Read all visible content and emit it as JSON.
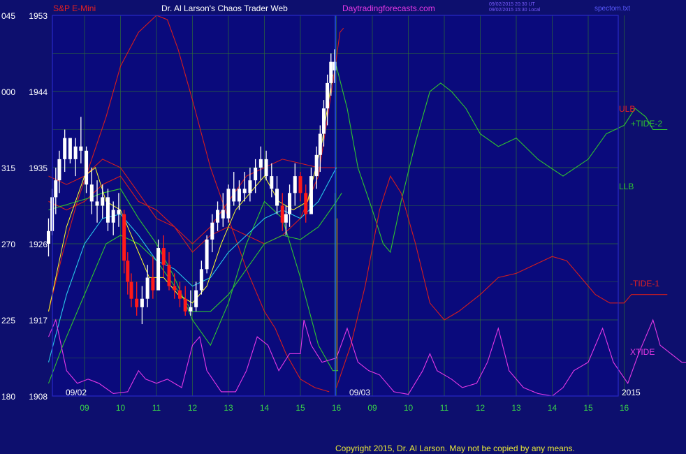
{
  "header": {
    "symbol": "S&P E-Mini",
    "title": "Dr. Al Larson's Chaos Trader Web",
    "site": "Daytradingforecasts.com",
    "timestamp_utc": "09/02/2015 20:30 UT",
    "timestamp_local": "09/02/2015 15:30 Local",
    "file": "spectom.txt"
  },
  "footer": {
    "copyright": "Copyright 2015, Dr. Al Larson. May not be copied by any means."
  },
  "colors": {
    "background": "#0d0f6e",
    "plot_background": "#0a0a7c",
    "grid": "#2e6a3a",
    "frame": "#2828c8",
    "axis_text_y": "#ffffff",
    "axis_text_x": "#39d24a",
    "red_series": "#d61d1d",
    "green_series": "#2fc52f",
    "cyan_series": "#28c8e8",
    "yellow_series": "#ffff28",
    "magenta_series": "#e638e6",
    "bars": "#ffffff",
    "bars_down": "#ff1a1a",
    "divider": "#2a6cff",
    "magenta_text": "#e638e6",
    "red_text": "#e82020"
  },
  "chart_data": {
    "type": "line",
    "y_axis": {
      "price_ticks": [
        "1908",
        "1917",
        "1926",
        "1935",
        "1944",
        "1953"
      ],
      "left_ticks": [
        "180",
        "225",
        "270",
        "315",
        "000",
        "045"
      ],
      "ylim": [
        1908,
        1953
      ]
    },
    "x_axis": {
      "hour_ticks": [
        "09",
        "10",
        "11",
        "12",
        "13",
        "14",
        "15",
        "16",
        "09",
        "10",
        "11",
        "12",
        "13",
        "14",
        "15",
        "16"
      ],
      "date_labels": [
        "09/02",
        "09/03"
      ],
      "year_label": "2015"
    },
    "grid": true,
    "day_divider_hour": 16,
    "series_labels": [
      {
        "text": "ULB",
        "color": "red"
      },
      {
        "text": "+TIDE-2",
        "color": "green"
      },
      {
        "text": "LLB",
        "color": "green"
      },
      {
        "text": "-TIDE-1",
        "color": "red"
      },
      {
        "text": "XTIDE",
        "color": "magenta"
      }
    ],
    "price_bars_day1": [
      [
        8.0,
        1924.5,
        1929.0,
        1926.0,
        1927.5
      ],
      [
        8.1,
        1927.0,
        1932.5,
        1927.5,
        1931.5
      ],
      [
        8.2,
        1929.5,
        1935.0,
        1931.5,
        1933.5
      ],
      [
        8.3,
        1932.0,
        1937.0,
        1933.5,
        1936.0
      ],
      [
        8.45,
        1934.5,
        1939.5,
        1936.0,
        1938.5
      ],
      [
        8.6,
        1935.5,
        1938.0,
        1938.5,
        1936.0
      ],
      [
        8.75,
        1934.0,
        1938.5,
        1936.0,
        1937.5
      ],
      [
        8.9,
        1935.5,
        1941.0,
        1937.5,
        1937.0
      ],
      [
        9.05,
        1932.0,
        1937.5,
        1937.0,
        1933.0
      ],
      [
        9.2,
        1929.5,
        1935.0,
        1933.0,
        1931.0
      ],
      [
        9.35,
        1928.5,
        1933.5,
        1931.0,
        1930.5
      ],
      [
        9.5,
        1929.0,
        1933.0,
        1930.5,
        1931.5
      ],
      [
        9.65,
        1927.5,
        1932.5,
        1931.5,
        1928.5
      ],
      [
        9.8,
        1927.0,
        1931.0,
        1928.5,
        1930.0
      ],
      [
        9.95,
        1928.0,
        1932.0,
        1930.0,
        1929.5
      ],
      [
        10.1,
        1922.5,
        1930.0,
        1929.5,
        1924.0
      ],
      [
        10.2,
        1920.0,
        1925.0,
        1924.0,
        1921.5
      ],
      [
        10.3,
        1918.5,
        1922.5,
        1921.5,
        1919.5
      ],
      [
        10.45,
        1917.5,
        1921.5,
        1919.5,
        1918.5
      ],
      [
        10.6,
        1916.5,
        1921.0,
        1918.5,
        1919.5
      ],
      [
        10.75,
        1918.5,
        1923.5,
        1919.5,
        1922.0
      ],
      [
        10.9,
        1919.5,
        1924.5,
        1922.0,
        1920.5
      ],
      [
        11.05,
        1921.0,
        1926.5,
        1920.5,
        1925.5
      ],
      [
        11.2,
        1922.0,
        1927.0,
        1925.5,
        1923.5
      ],
      [
        11.35,
        1920.5,
        1925.0,
        1923.5,
        1921.0
      ],
      [
        11.5,
        1919.5,
        1922.5,
        1921.0,
        1920.5
      ],
      [
        11.65,
        1918.5,
        1921.5,
        1920.5,
        1919.5
      ],
      [
        11.8,
        1917.5,
        1921.0,
        1919.5,
        1918.0
      ],
      [
        11.95,
        1917.5,
        1920.5,
        1918.0,
        1918.5
      ],
      [
        12.1,
        1918.0,
        1921.5,
        1918.5,
        1920.5
      ],
      [
        12.25,
        1920.0,
        1924.0,
        1920.5,
        1923.0
      ],
      [
        12.4,
        1922.5,
        1927.0,
        1923.0,
        1926.5
      ],
      [
        12.55,
        1925.0,
        1929.5,
        1926.5,
        1928.5
      ],
      [
        12.7,
        1927.5,
        1931.0,
        1928.5,
        1930.0
      ],
      [
        12.85,
        1928.0,
        1932.0,
        1930.0,
        1929.0
      ],
      [
        13.0,
        1928.5,
        1933.0,
        1929.0,
        1932.5
      ],
      [
        13.15,
        1930.5,
        1934.5,
        1932.5,
        1931.0
      ],
      [
        13.3,
        1930.0,
        1933.5,
        1931.0,
        1932.5
      ],
      [
        13.45,
        1931.0,
        1934.5,
        1932.5,
        1932.0
      ],
      [
        13.6,
        1931.0,
        1935.0,
        1932.0,
        1933.5
      ],
      [
        13.75,
        1932.0,
        1936.0,
        1933.5,
        1935.0
      ],
      [
        13.9,
        1933.5,
        1937.5,
        1935.0,
        1936.0
      ],
      [
        14.05,
        1933.5,
        1937.0,
        1936.0,
        1934.0
      ],
      [
        14.2,
        1931.5,
        1935.5,
        1934.0,
        1932.5
      ],
      [
        14.35,
        1929.5,
        1934.0,
        1932.5,
        1930.5
      ],
      [
        14.5,
        1927.5,
        1932.0,
        1930.5,
        1928.5
      ],
      [
        14.6,
        1927.0,
        1930.5,
        1928.5,
        1929.5
      ],
      [
        14.7,
        1928.0,
        1933.0,
        1929.5,
        1932.0
      ],
      [
        14.85,
        1930.5,
        1935.5,
        1932.0,
        1934.0
      ],
      [
        15.0,
        1931.0,
        1934.5,
        1934.0,
        1932.0
      ],
      [
        15.15,
        1928.5,
        1933.0,
        1932.0,
        1929.5
      ],
      [
        15.3,
        1930.0,
        1935.0,
        1929.5,
        1934.0
      ],
      [
        15.45,
        1932.5,
        1937.5,
        1934.0,
        1936.5
      ],
      [
        15.55,
        1934.5,
        1940.0,
        1936.5,
        1939.0
      ],
      [
        15.65,
        1937.5,
        1943.0,
        1939.0,
        1942.0
      ],
      [
        15.75,
        1940.0,
        1946.0,
        1942.0,
        1945.0
      ],
      [
        15.85,
        1943.5,
        1948.5,
        1945.0,
        1947.5
      ],
      [
        15.95,
        1945.0,
        1949.0,
        1947.5,
        1946.5
      ]
    ]
  }
}
